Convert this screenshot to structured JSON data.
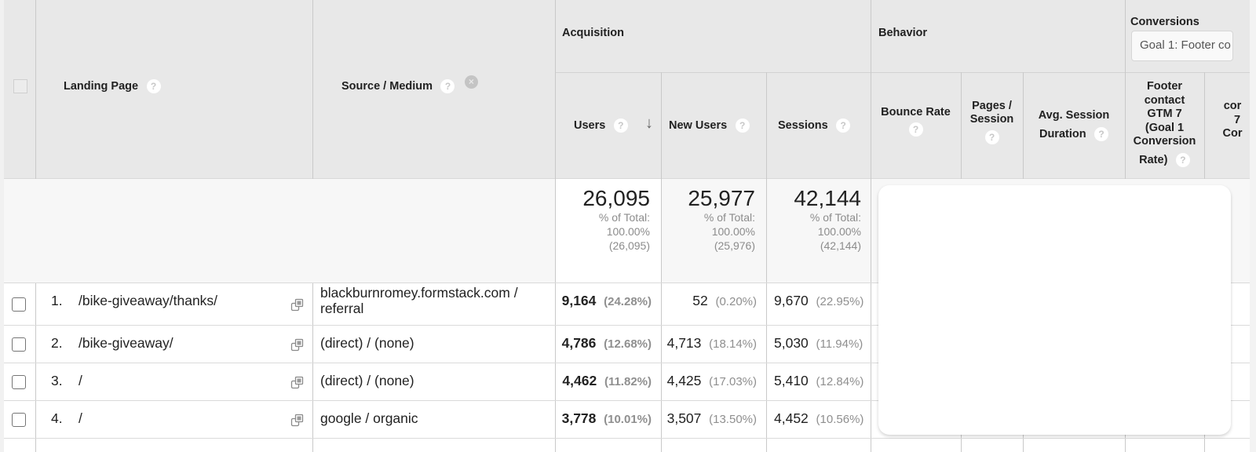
{
  "header": {
    "landing_page": "Landing Page",
    "source_medium": "Source / Medium",
    "groups": {
      "acquisition": "Acquisition",
      "behavior": "Behavior",
      "conversions": "Conversions"
    },
    "conversion_goal_selected": "Goal 1: Footer co",
    "columns": {
      "users": "Users",
      "new_users": "New Users",
      "sessions": "Sessions",
      "bounce_rate": "Bounce Rate",
      "pages_session_1": "Pages /",
      "pages_session_2": "Session",
      "avg_session_1": "Avg. Session",
      "avg_session_2": "Duration",
      "goal_rate_1": "Footer",
      "goal_rate_2": "contact",
      "goal_rate_3": "GTM 7",
      "goal_rate_4": "(Goal 1",
      "goal_rate_5": "Conversion",
      "goal_rate_6": "Rate)",
      "goal_next_1": "cor",
      "goal_next_2": "7",
      "goal_next_3": "Cor"
    },
    "help_glyph": "?",
    "remove_glyph": "×",
    "sort_glyph": "↓"
  },
  "totals": {
    "pct_label": "% of Total:",
    "users": {
      "value": "26,095",
      "pct": "100.00%",
      "of": "(26,095)"
    },
    "new_users": {
      "value": "25,977",
      "pct": "100.00%",
      "of": "(25,976)"
    },
    "sessions": {
      "value": "42,144",
      "pct": "100.00%",
      "of": "(42,144)"
    }
  },
  "rows": [
    {
      "index": "1.",
      "landing_page": "/bike-giveaway/thanks/",
      "source_medium_1": "blackburnromey.formstack.com /",
      "source_medium_2": "referral",
      "users": "9,164",
      "users_pct": "(24.28%)",
      "new_users": "52",
      "new_users_pct": "(0.20%)",
      "sessions": "9,670",
      "sessions_pct": "(22.95%)"
    },
    {
      "index": "2.",
      "landing_page": "/bike-giveaway/",
      "source_medium_1": "(direct) / (none)",
      "source_medium_2": "",
      "users": "4,786",
      "users_pct": "(12.68%)",
      "new_users": "4,713",
      "new_users_pct": "(18.14%)",
      "sessions": "5,030",
      "sessions_pct": "(11.94%)"
    },
    {
      "index": "3.",
      "landing_page": "/",
      "source_medium_1": "(direct) / (none)",
      "source_medium_2": "",
      "users": "4,462",
      "users_pct": "(11.82%)",
      "new_users": "4,425",
      "new_users_pct": "(17.03%)",
      "sessions": "5,410",
      "sessions_pct": "(12.84%)"
    },
    {
      "index": "4.",
      "landing_page": "/",
      "source_medium_1": "google / organic",
      "source_medium_2": "",
      "users": "3,778",
      "users_pct": "(10.01%)",
      "new_users": "3,507",
      "new_users_pct": "(13.50%)",
      "sessions": "4,452",
      "sessions_pct": "(10.56%)"
    }
  ]
}
